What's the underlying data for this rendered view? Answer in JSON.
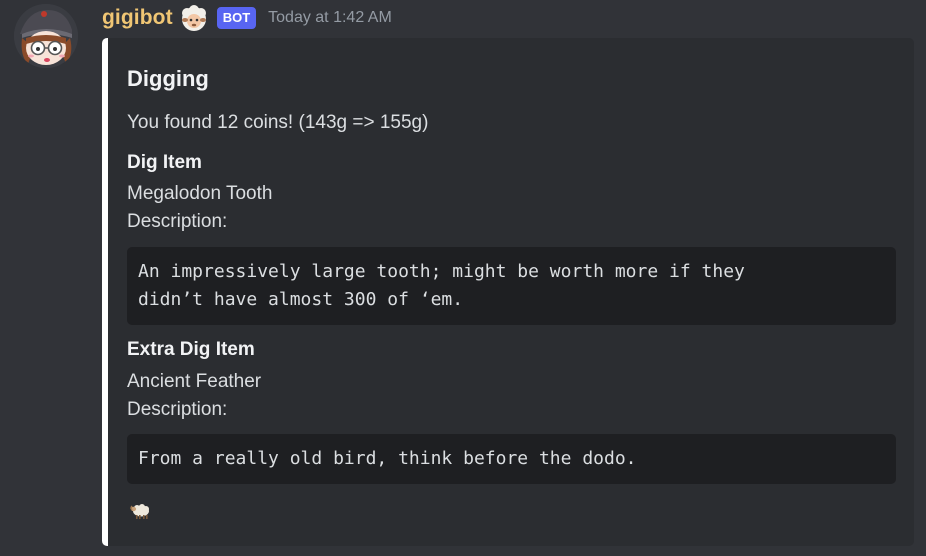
{
  "message": {
    "author": "gigibot",
    "author_emoji": "sheep-emoji",
    "bot_tag": "BOT",
    "timestamp": "Today at 1:42 AM",
    "colors": {
      "username": "#f0c674",
      "bot_tag": "#5865f2",
      "embed_border": "#ffffff",
      "embed_bg": "#2b2d31",
      "code_bg": "#1e1f22"
    }
  },
  "embed": {
    "title": "Digging",
    "description": "You found 12 coins! (143g => 155g)",
    "fields": [
      {
        "name": "Dig Item",
        "item": "Megalodon Tooth",
        "description_label": "Description:",
        "code": "An impressively large tooth; might be worth more if they\ndidn’t have almost 300 of ‘em."
      },
      {
        "name": "Extra Dig Item",
        "item": "Ancient Feather",
        "description_label": "Description:",
        "code": "From a really old bird, think before the dodo."
      }
    ],
    "footer_icon": "ram-emoji"
  }
}
